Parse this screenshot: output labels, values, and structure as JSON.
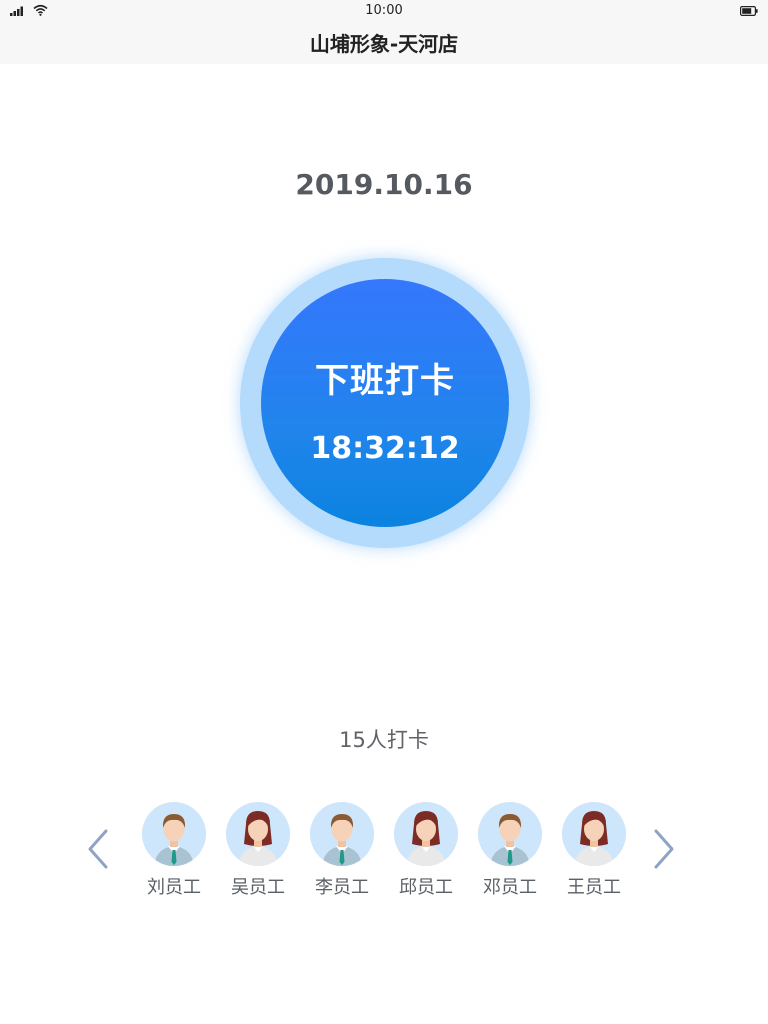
{
  "status_bar": {
    "time": "10:00",
    "signal_icon": "signal-icon",
    "wifi_icon": "wifi-icon",
    "battery_icon": "battery-icon"
  },
  "header": {
    "title": "山埔形象-天河店"
  },
  "date": "2019.10.16",
  "punch": {
    "label": "下班打卡",
    "time": "18:32:12"
  },
  "count_text": "15人打卡",
  "employees": [
    {
      "name": "刘员工",
      "gender": "male"
    },
    {
      "name": "吴员工",
      "gender": "female"
    },
    {
      "name": "李员工",
      "gender": "male"
    },
    {
      "name": "邱员工",
      "gender": "female"
    },
    {
      "name": "邓员工",
      "gender": "male"
    },
    {
      "name": "王员工",
      "gender": "female"
    }
  ],
  "colors": {
    "accent": "#2a7cf0",
    "ring": "#b4dafc",
    "arrow": "#8fa3c4",
    "avatar_bg": "#cde6fb"
  }
}
